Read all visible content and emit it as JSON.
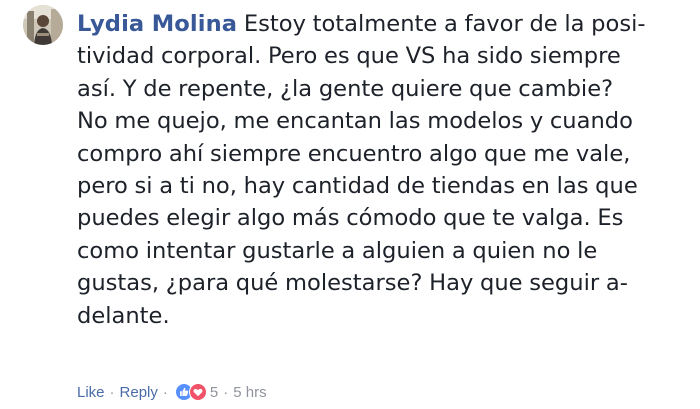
{
  "comment": {
    "author": "Lydia Molina",
    "text_lines": [
      "Estoy totalmente a favor de la posi-",
      "tividad corporal. Pero es que VS ha sido siempre",
      "así. Y de repente, ¿la gente quiere que cambie?",
      "No me quejo, me encantan las modelos y cuando",
      "compro ahí siempre encuentro algo que me vale,",
      "pero si a ti no, hay cantidad de tiendas en las que",
      "puedes elegir algo más cómodo que te valga. Es",
      "como intentar gustarle a alguien a quien no le",
      "gustas, ¿para qué molestarse? Hay que seguir a-",
      "delante."
    ],
    "actions": {
      "like_label": "Like",
      "reply_label": "Reply",
      "separator": "·",
      "reaction_count": "5",
      "timestamp": "5 hrs"
    },
    "reaction_icons": [
      "like-icon",
      "love-icon"
    ],
    "colors": {
      "author": "#385898",
      "text": "#1d2129",
      "action_link": "#4b6ca8",
      "meta": "#90949c",
      "like_blue": "#5890ff",
      "love_red": "#f25268"
    }
  }
}
